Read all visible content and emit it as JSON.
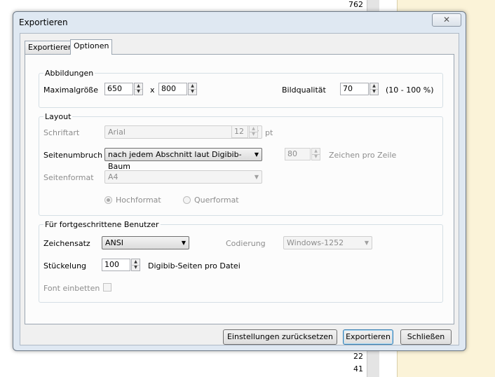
{
  "background": {
    "numbers_top": [
      "762"
    ],
    "numbers_bottom": [
      "22",
      "41"
    ]
  },
  "dialog": {
    "title": "Exportieren",
    "close_icon": "close-icon",
    "tabs": [
      {
        "label": "Exportieren",
        "active": false
      },
      {
        "label": "Optionen",
        "active": true
      }
    ],
    "abbildungen": {
      "legend": "Abbildungen",
      "maximalgroesse_label": "Maximalgröße",
      "width_value": "650",
      "x_label": "x",
      "height_value": "800",
      "bildqualitaet_label": "Bildqualität",
      "quality_value": "70",
      "quality_range": "(10 - 100 %)"
    },
    "layout": {
      "legend": "Layout",
      "schriftart_label": "Schriftart",
      "schriftart_value": "Arial",
      "fontsize_value": "12",
      "pt_label": "pt",
      "seitenumbruch_label": "Seitenumbruch",
      "seitenumbruch_value": "nach jedem Abschnitt laut Digibib-Baum",
      "zeichen_value": "80",
      "zeichen_label": "Zeichen pro Zeile",
      "seitenformat_label": "Seitenformat",
      "seitenformat_value": "A4",
      "hochformat_label": "Hochformat",
      "querformat_label": "Querformat",
      "hochformat_selected": true
    },
    "advanced": {
      "legend": "Für fortgeschrittene Benutzer",
      "zeichensatz_label": "Zeichensatz",
      "zeichensatz_value": "ANSI",
      "codierung_label": "Codierung",
      "codierung_value": "Windows-1252",
      "stueckelung_label": "Stückelung",
      "stueckelung_value": "100",
      "stueckelung_suffix": "Digibib-Seiten pro Datei",
      "font_einbetten_label": "Font einbetten",
      "font_einbetten_checked": false
    },
    "buttons": {
      "reset": "Einstellungen zurücksetzen",
      "export": "Exportieren",
      "close": "Schließen"
    }
  }
}
